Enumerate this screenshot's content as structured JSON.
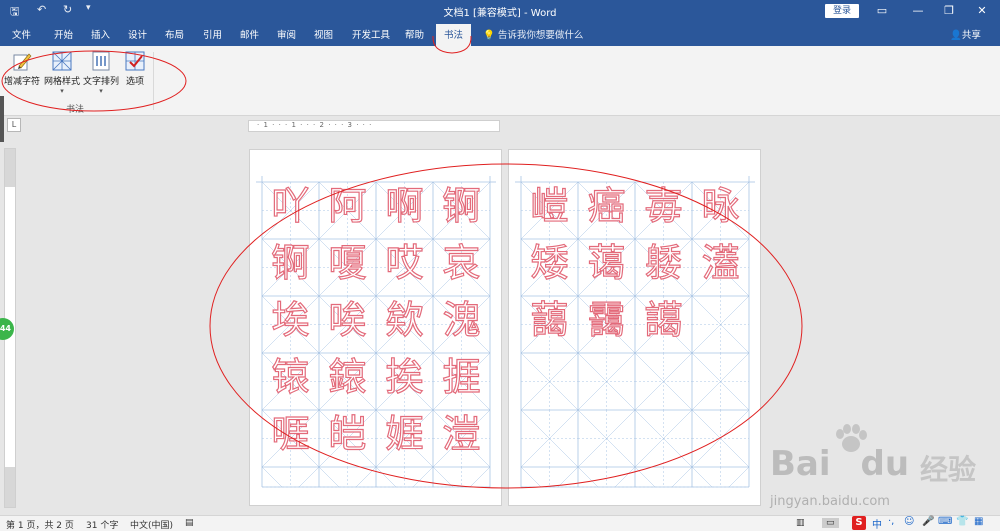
{
  "titlebar": {
    "title": "文档1 [兼容模式] - Word",
    "login": "登录",
    "qa_save": "🖫",
    "qa_undo": "↶",
    "qa_redo": "↻",
    "qa_more": "▾",
    "win_ribbon": "▭",
    "win_min": "—",
    "win_max": "❐",
    "win_close": "✕"
  },
  "menu": {
    "tabs": [
      "文件",
      "开始",
      "插入",
      "设计",
      "布局",
      "引用",
      "邮件",
      "审阅",
      "视图",
      "开发工具",
      "帮助",
      "书法"
    ],
    "active": "书法",
    "tell_me": "告诉我你想要做什么",
    "share": "共享"
  },
  "ribbon": {
    "buttons": [
      {
        "label": "增减字符",
        "icon": "calligraphy-pen-icon"
      },
      {
        "label": "网格样式",
        "icon": "grid-style-icon"
      },
      {
        "label": "文字排列",
        "icon": "text-arrange-icon"
      },
      {
        "label": "选项",
        "icon": "options-check-icon"
      }
    ],
    "group_label": "书法"
  },
  "ruler": {
    "corner": "L",
    "top_numbers": "· 1 · · · 1 · · · 2 · · · 3 · · ·",
    "side_badge": "44"
  },
  "pages": [
    {
      "chars": [
        "吖",
        "阿",
        "啊",
        "锕",
        "锕",
        "嗄",
        "哎",
        "哀",
        "埃",
        "唉",
        "欸",
        "溾",
        "锿",
        "鎄",
        "挨",
        "捱",
        "啀",
        "皑",
        "娾",
        "溰"
      ]
    },
    {
      "chars": [
        "嵦",
        "癌",
        "毐",
        "昹",
        "矮",
        "蔼",
        "躷",
        "濭",
        "藹",
        "靄",
        "譪"
      ]
    }
  ],
  "colors": {
    "brand": "#2b579a",
    "char_stroke": "#e36a7a",
    "grid_line": "#a9c4e4",
    "annotation": "#e02020"
  },
  "statusbar": {
    "page": "第 1 页，共 2 页",
    "words": "31 个字",
    "lang": "中文(中国)"
  },
  "watermark": {
    "brand": "Bai",
    "brand2": "du",
    "cn": "经验",
    "url": "jingyan.baidu.com"
  },
  "ime": {
    "logo": "S",
    "items": [
      "中",
      "·,",
      "☺",
      "🎤",
      "⌨",
      "👕",
      "▦"
    ]
  }
}
